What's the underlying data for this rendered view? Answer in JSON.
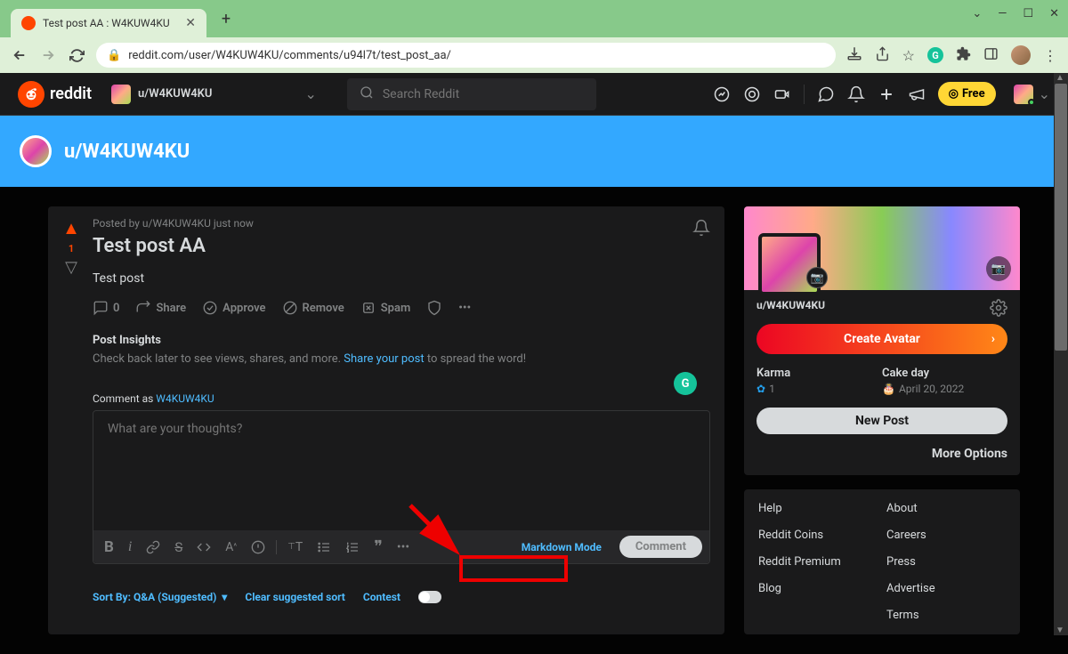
{
  "tab": {
    "title": "Test post AA : W4KUW4KU"
  },
  "url": "reddit.com/user/W4KUW4KU/comments/u94l7t/test_post_aa/",
  "redditHeader": {
    "brand": "reddit",
    "userLabel": "u/W4KUW4KU",
    "searchPlaceholder": "Search Reddit",
    "freeLabel": "Free"
  },
  "banner": {
    "username": "u/W4KUW4KU"
  },
  "post": {
    "bylinePrefix": "Posted by ",
    "author": "u/W4KUW4KU",
    "when": "just now",
    "score": "1",
    "title": "Test post AA",
    "body": "Test post",
    "actions": {
      "comments": "0",
      "share": "Share",
      "approve": "Approve",
      "remove": "Remove",
      "spam": "Spam"
    },
    "insights": {
      "heading": "Post Insights",
      "textBefore": "Check back later to see views, shares, and more. ",
      "link": "Share your post",
      "textAfter": " to spread the word!"
    },
    "commentAsLabel": "Comment as ",
    "commentAsUser": "W4KUW4KU",
    "editorPlaceholder": "What are your thoughts?",
    "markdownMode": "Markdown Mode",
    "commentBtn": "Comment",
    "sort": {
      "label": "Sort By: Q&A (Suggested)",
      "clear": "Clear suggested sort",
      "contest": "Contest"
    }
  },
  "profileCard": {
    "username": "u/W4KUW4KU",
    "createAvatar": "Create Avatar",
    "karmaLabel": "Karma",
    "karmaValue": "1",
    "cakeLabel": "Cake day",
    "cakeValue": "April 20, 2022",
    "newPost": "New Post",
    "moreOptions": "More Options"
  },
  "footerLinks": {
    "col1": [
      "Help",
      "Reddit Coins",
      "Reddit Premium",
      "Blog"
    ],
    "col2": [
      "About",
      "Careers",
      "Press",
      "Advertise",
      "Terms"
    ]
  }
}
